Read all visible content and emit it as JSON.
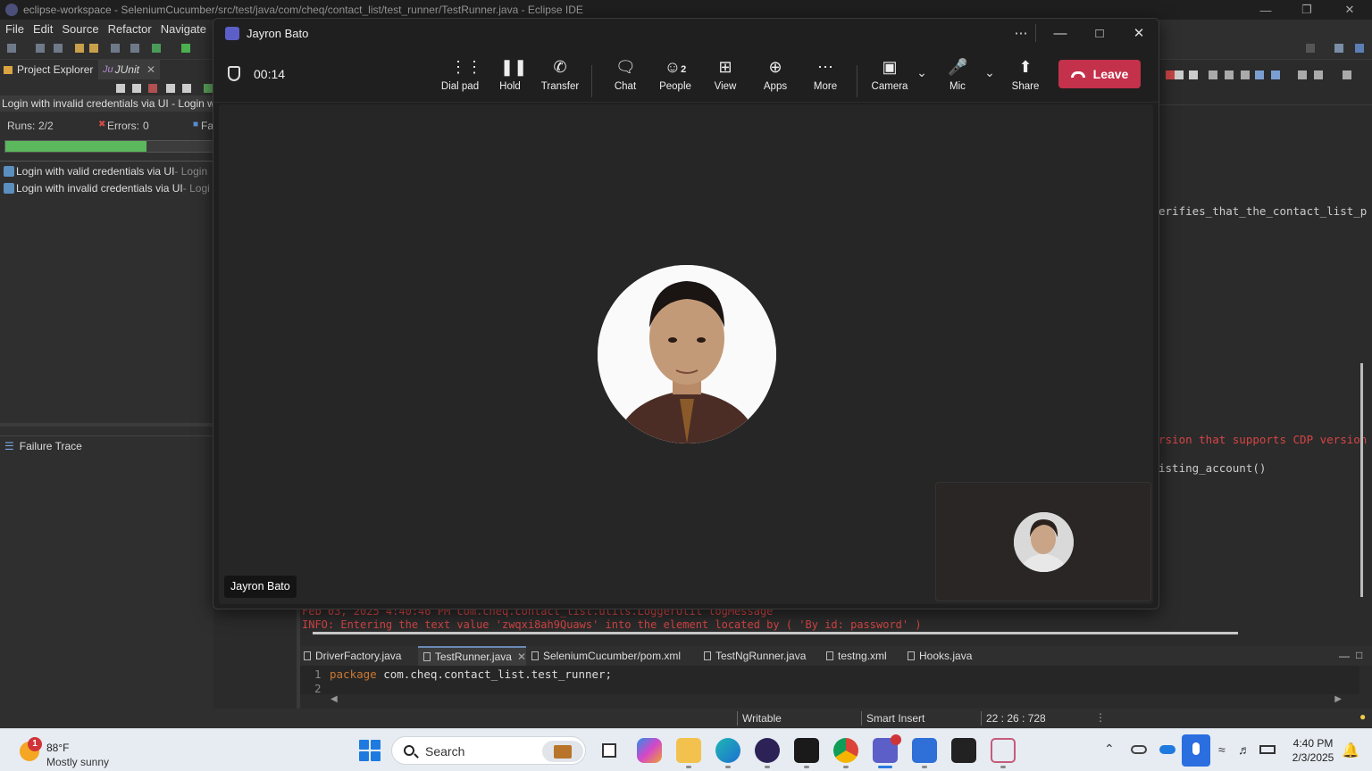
{
  "eclipse": {
    "window_title": "eclipse-workspace - SeleniumCucumber/src/test/java/com/cheq/contact_list/test_runner/TestRunner.java - Eclipse IDE",
    "menu": [
      "File",
      "Edit",
      "Source",
      "Refactor",
      "Navigate"
    ],
    "left_tabs": {
      "project_explorer": "Project Explorer",
      "junit": "JUnit"
    },
    "junit_status": "Login with invalid credentials via UI - Login with invalid credentials via UI",
    "runs_label": "Runs:",
    "runs_value": "2/2",
    "errors_label": "Errors:",
    "errors_value": "0",
    "failures_label": "Fai",
    "progress": 0.68,
    "tests": [
      {
        "name": "Login with valid credentials via UI",
        "suffix": " - Login"
      },
      {
        "name": "Login with invalid credentials via UI",
        "suffix": " - Logi"
      }
    ],
    "failure_trace": "Failure Trace",
    "right_code": {
      "line1": "erifies_that_the_contact_list_p",
      "line2": "rsion that supports CDP version",
      "line3": "isting_account()"
    },
    "console": {
      "line1": "Feb 03, 2025 4:40:46 PM com.cheq.contact_list.utils.LoggerUtil logMessage",
      "line2": "INFO: Entering the text value 'zwqxi8ah9Quaws' into the element located by ( 'By id: password' )"
    },
    "editor_tabs": [
      "DriverFactory.java",
      "TestRunner.java",
      "SeleniumCucumber/pom.xml",
      "TestNgRunner.java",
      "testng.xml",
      "Hooks.java"
    ],
    "editor_lines": [
      {
        "num": "1",
        "keyword": "package",
        "rest": " com.cheq.contact_list.test_runner;"
      },
      {
        "num": "2",
        "keyword": "",
        "rest": ""
      }
    ],
    "status": {
      "writable": "Writable",
      "insert": "Smart Insert",
      "position": "22 : 26 : 728"
    }
  },
  "teams": {
    "title": "Jayron Bato",
    "timer": "00:14",
    "buttons": {
      "dial_pad": "Dial pad",
      "hold": "Hold",
      "transfer": "Transfer",
      "chat": "Chat",
      "people": "People",
      "people_count": "2",
      "view": "View",
      "apps": "Apps",
      "more": "More",
      "camera": "Camera",
      "mic": "Mic",
      "share": "Share",
      "leave": "Leave"
    },
    "participant_name": "Jayron Bato",
    "colors": {
      "leave": "#c4314b",
      "teams_brand": "#5b5fc7"
    }
  },
  "taskbar": {
    "weather_temp": "88°F",
    "weather_cond": "Mostly sunny",
    "weather_badge": "1",
    "search": "Search",
    "time": "4:40 PM",
    "date": "2/3/2025"
  }
}
